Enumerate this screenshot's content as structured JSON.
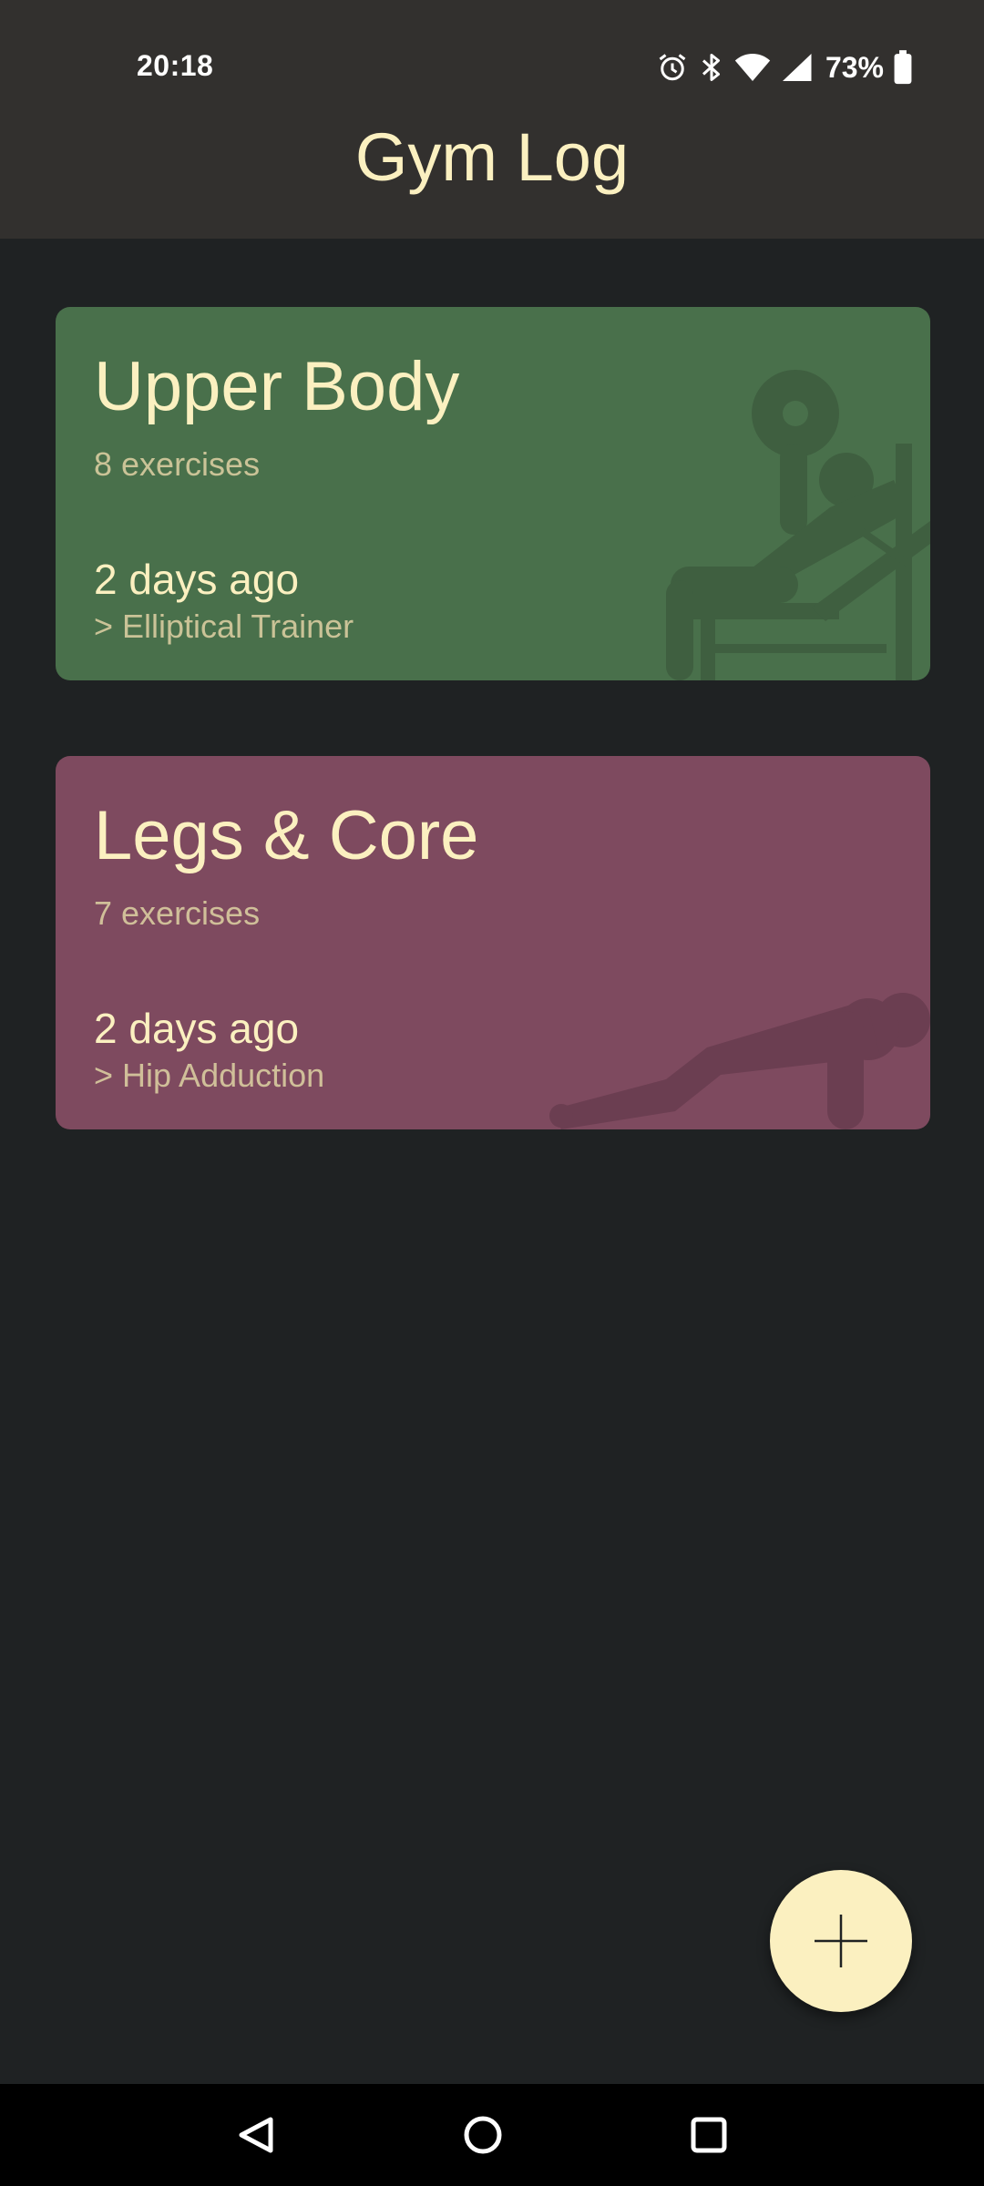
{
  "status_bar": {
    "time": "20:18",
    "battery": "73%",
    "icons": [
      "alarm-icon",
      "bluetooth-icon",
      "wifi-icon",
      "cellular-signal-icon",
      "battery-icon"
    ]
  },
  "app_bar": {
    "title": "Gym Log"
  },
  "workouts": [
    {
      "title": "Upper Body",
      "exercise_count": "8 exercises",
      "last_performed": "2 days ago",
      "last_exercise": "> Elliptical Trainer",
      "color": "#49704b",
      "illustration": "bench-press-icon"
    },
    {
      "title": "Legs & Core",
      "exercise_count": "7 exercises",
      "last_performed": "2 days ago",
      "last_exercise": "> Hip Adduction",
      "color": "#7e4a5f",
      "illustration": "push-up-icon"
    }
  ],
  "fab": {
    "icon": "plus-icon",
    "color": "#fbf0c0"
  },
  "nav_bar": {
    "icons": [
      "back-icon",
      "home-icon",
      "recents-icon"
    ]
  },
  "colors": {
    "background": "#1f2223",
    "app_bar": "#32302e",
    "accent_text": "#fbf0c0"
  }
}
